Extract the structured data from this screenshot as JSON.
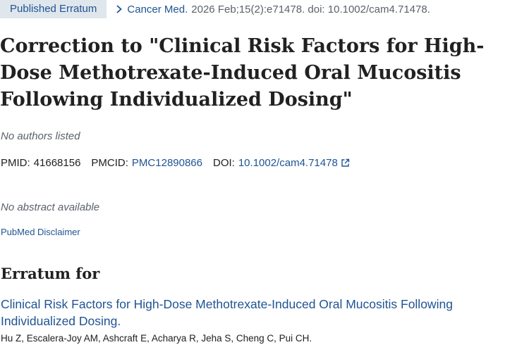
{
  "header": {
    "publication_type": "Published Erratum",
    "journal": "Cancer Med.",
    "citation_details": "2026 Feb;15(2):e71478. doi: 10.1002/cam4.71478."
  },
  "article": {
    "title": "Correction to \"Clinical Risk Factors for High-Dose Methotrexate-Induced Oral Mucositis Following Individualized Dosing\"",
    "authors_note": "No authors listed",
    "identifiers": {
      "pmid_label": "PMID:",
      "pmid": "41668156",
      "pmcid_label": "PMCID:",
      "pmcid": "PMC12890866",
      "doi_label": "DOI:",
      "doi": "10.1002/cam4.71478"
    },
    "abstract_note": "No abstract available",
    "disclaimer_link": "PubMed Disclaimer"
  },
  "erratum_for": {
    "heading": "Erratum for",
    "title": "Clinical Risk Factors for High-Dose Methotrexate-Induced Oral Mucositis Following Individualized Dosing.",
    "authors": "Hu Z, Escalera-Joy AM, Ashcraft E, Acharya R, Jeha S, Cheng C, Pui CH."
  },
  "icons": {
    "chevron": "chevron-right-icon",
    "external_link": "external-link-icon"
  },
  "colors": {
    "link": "#205493",
    "badge_bg": "#dfe6ec",
    "muted_text": "#5b616b",
    "body_text": "#212121"
  }
}
